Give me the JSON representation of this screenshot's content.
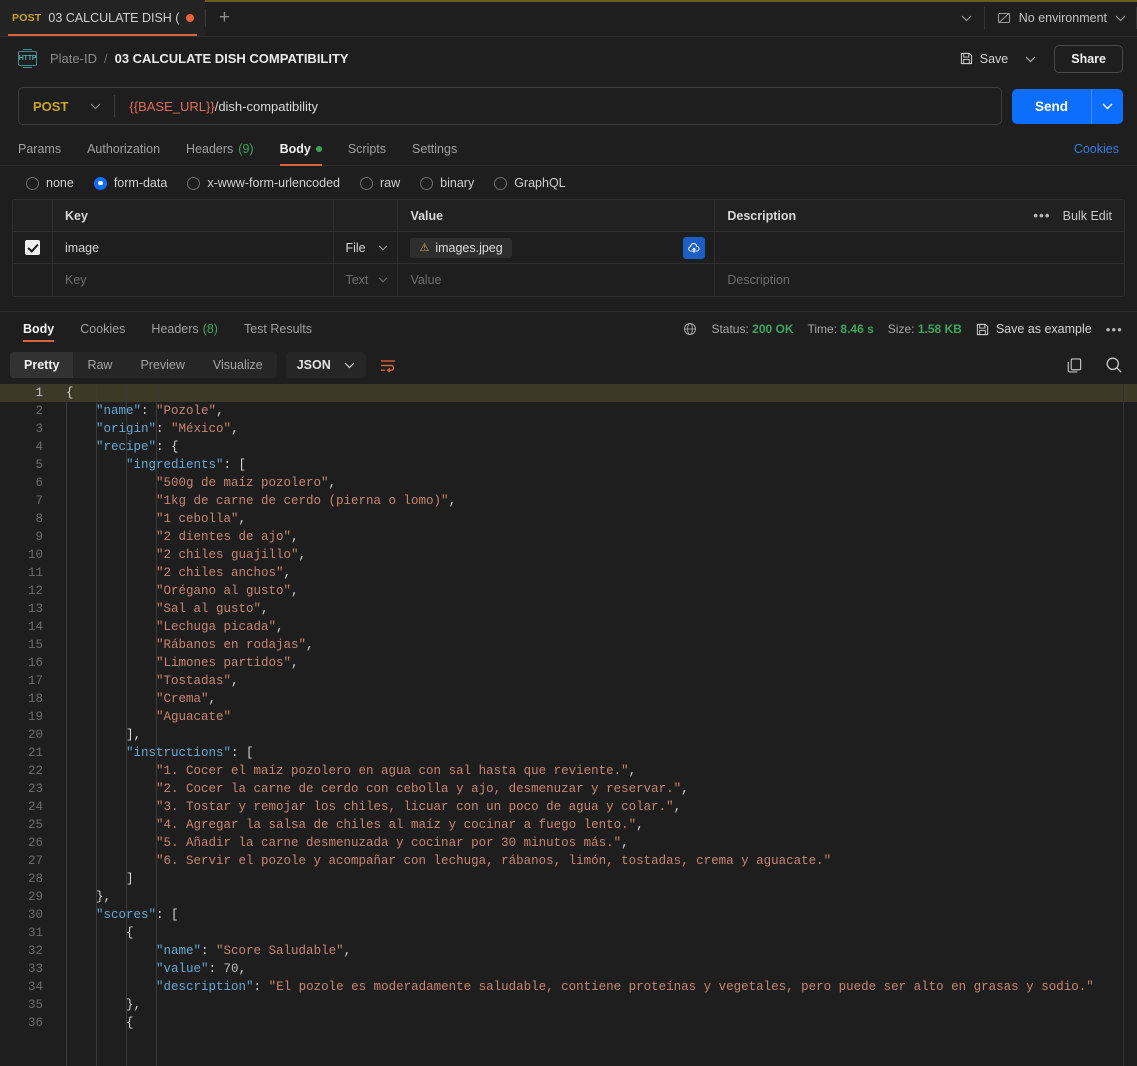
{
  "tabbar": {
    "tab_method": "POST",
    "tab_title": "03 CALCULATE DISH (",
    "add_label": "+",
    "environment": "No environment"
  },
  "header": {
    "badge": "HTTP",
    "collection": "Plate-ID",
    "separator": "/",
    "request_name": "03 CALCULATE DISH COMPATIBILITY",
    "save_label": "Save",
    "share_label": "Share"
  },
  "url_bar": {
    "method": "POST",
    "url_variable": "{{BASE_URL}}",
    "url_path": "/dish-compatibility",
    "send_label": "Send"
  },
  "request_tabs": {
    "items": [
      {
        "label": "Params",
        "active": false
      },
      {
        "label": "Authorization",
        "active": false
      },
      {
        "label": "Headers",
        "count": "(9)",
        "active": false
      },
      {
        "label": "Body",
        "active": true,
        "dot": true
      },
      {
        "label": "Scripts",
        "active": false
      },
      {
        "label": "Settings",
        "active": false
      }
    ],
    "cookies_link": "Cookies"
  },
  "body_type": {
    "options": [
      {
        "label": "none",
        "selected": false
      },
      {
        "label": "form-data",
        "selected": true
      },
      {
        "label": "x-www-form-urlencoded",
        "selected": false
      },
      {
        "label": "raw",
        "selected": false
      },
      {
        "label": "binary",
        "selected": false
      },
      {
        "label": "GraphQL",
        "selected": false
      }
    ]
  },
  "form_data": {
    "headers": {
      "key": "Key",
      "value": "Value",
      "description": "Description",
      "bulk_edit": "Bulk Edit"
    },
    "rows": [
      {
        "checked": true,
        "key": "image",
        "type": "File",
        "value": "images.jpeg",
        "description": ""
      }
    ],
    "placeholder_row": {
      "key": "Key",
      "type": "Text",
      "value": "Value",
      "description": "Description"
    }
  },
  "response": {
    "tabs": [
      {
        "label": "Body",
        "active": true
      },
      {
        "label": "Cookies",
        "active": false
      },
      {
        "label": "Headers",
        "count": "(8)",
        "active": false
      },
      {
        "label": "Test Results",
        "active": false
      }
    ],
    "status_label": "Status:",
    "status_value": "200 OK",
    "time_label": "Time:",
    "time_value": "8.46 s",
    "size_label": "Size:",
    "size_value": "1.58 KB",
    "save_as_example": "Save as example",
    "format_tabs": [
      {
        "label": "Pretty",
        "active": true
      },
      {
        "label": "Raw",
        "active": false
      },
      {
        "label": "Preview",
        "active": false
      },
      {
        "label": "Visualize",
        "active": false
      }
    ],
    "language": "JSON"
  },
  "code": {
    "lines": [
      {
        "n": 1,
        "hl": true,
        "tokens": [
          {
            "t": "p",
            "v": "{"
          }
        ]
      },
      {
        "n": 2,
        "tokens": [
          {
            "t": "p",
            "v": "    "
          },
          {
            "t": "k",
            "v": "\"name\""
          },
          {
            "t": "p",
            "v": ": "
          },
          {
            "t": "s",
            "v": "\"Pozole\""
          },
          {
            "t": "p",
            "v": ","
          }
        ]
      },
      {
        "n": 3,
        "tokens": [
          {
            "t": "p",
            "v": "    "
          },
          {
            "t": "k",
            "v": "\"origin\""
          },
          {
            "t": "p",
            "v": ": "
          },
          {
            "t": "s",
            "v": "\"México\""
          },
          {
            "t": "p",
            "v": ","
          }
        ]
      },
      {
        "n": 4,
        "tokens": [
          {
            "t": "p",
            "v": "    "
          },
          {
            "t": "k",
            "v": "\"recipe\""
          },
          {
            "t": "p",
            "v": ": {"
          }
        ]
      },
      {
        "n": 5,
        "tokens": [
          {
            "t": "p",
            "v": "        "
          },
          {
            "t": "k",
            "v": "\"ingredients\""
          },
          {
            "t": "p",
            "v": ": ["
          }
        ]
      },
      {
        "n": 6,
        "tokens": [
          {
            "t": "p",
            "v": "            "
          },
          {
            "t": "s",
            "v": "\"500g de maíz pozolero\""
          },
          {
            "t": "p",
            "v": ","
          }
        ]
      },
      {
        "n": 7,
        "tokens": [
          {
            "t": "p",
            "v": "            "
          },
          {
            "t": "s",
            "v": "\"1kg de carne de cerdo (pierna o lomo)\""
          },
          {
            "t": "p",
            "v": ","
          }
        ]
      },
      {
        "n": 8,
        "tokens": [
          {
            "t": "p",
            "v": "            "
          },
          {
            "t": "s",
            "v": "\"1 cebolla\""
          },
          {
            "t": "p",
            "v": ","
          }
        ]
      },
      {
        "n": 9,
        "tokens": [
          {
            "t": "p",
            "v": "            "
          },
          {
            "t": "s",
            "v": "\"2 dientes de ajo\""
          },
          {
            "t": "p",
            "v": ","
          }
        ]
      },
      {
        "n": 10,
        "tokens": [
          {
            "t": "p",
            "v": "            "
          },
          {
            "t": "s",
            "v": "\"2 chiles guajillo\""
          },
          {
            "t": "p",
            "v": ","
          }
        ]
      },
      {
        "n": 11,
        "tokens": [
          {
            "t": "p",
            "v": "            "
          },
          {
            "t": "s",
            "v": "\"2 chiles anchos\""
          },
          {
            "t": "p",
            "v": ","
          }
        ]
      },
      {
        "n": 12,
        "tokens": [
          {
            "t": "p",
            "v": "            "
          },
          {
            "t": "s",
            "v": "\"Orégano al gusto\""
          },
          {
            "t": "p",
            "v": ","
          }
        ]
      },
      {
        "n": 13,
        "tokens": [
          {
            "t": "p",
            "v": "            "
          },
          {
            "t": "s",
            "v": "\"Sal al gusto\""
          },
          {
            "t": "p",
            "v": ","
          }
        ]
      },
      {
        "n": 14,
        "tokens": [
          {
            "t": "p",
            "v": "            "
          },
          {
            "t": "s",
            "v": "\"Lechuga picada\""
          },
          {
            "t": "p",
            "v": ","
          }
        ]
      },
      {
        "n": 15,
        "tokens": [
          {
            "t": "p",
            "v": "            "
          },
          {
            "t": "s",
            "v": "\"Rábanos en rodajas\""
          },
          {
            "t": "p",
            "v": ","
          }
        ]
      },
      {
        "n": 16,
        "tokens": [
          {
            "t": "p",
            "v": "            "
          },
          {
            "t": "s",
            "v": "\"Limones partidos\""
          },
          {
            "t": "p",
            "v": ","
          }
        ]
      },
      {
        "n": 17,
        "tokens": [
          {
            "t": "p",
            "v": "            "
          },
          {
            "t": "s",
            "v": "\"Tostadas\""
          },
          {
            "t": "p",
            "v": ","
          }
        ]
      },
      {
        "n": 18,
        "tokens": [
          {
            "t": "p",
            "v": "            "
          },
          {
            "t": "s",
            "v": "\"Crema\""
          },
          {
            "t": "p",
            "v": ","
          }
        ]
      },
      {
        "n": 19,
        "tokens": [
          {
            "t": "p",
            "v": "            "
          },
          {
            "t": "s",
            "v": "\"Aguacate\""
          }
        ]
      },
      {
        "n": 20,
        "tokens": [
          {
            "t": "p",
            "v": "        ],"
          }
        ]
      },
      {
        "n": 21,
        "tokens": [
          {
            "t": "p",
            "v": "        "
          },
          {
            "t": "k",
            "v": "\"instructions\""
          },
          {
            "t": "p",
            "v": ": ["
          }
        ]
      },
      {
        "n": 22,
        "tokens": [
          {
            "t": "p",
            "v": "            "
          },
          {
            "t": "s",
            "v": "\"1. Cocer el maíz pozolero en agua con sal hasta que reviente.\""
          },
          {
            "t": "p",
            "v": ","
          }
        ]
      },
      {
        "n": 23,
        "tokens": [
          {
            "t": "p",
            "v": "            "
          },
          {
            "t": "s",
            "v": "\"2. Cocer la carne de cerdo con cebolla y ajo, desmenuzar y reservar.\""
          },
          {
            "t": "p",
            "v": ","
          }
        ]
      },
      {
        "n": 24,
        "tokens": [
          {
            "t": "p",
            "v": "            "
          },
          {
            "t": "s",
            "v": "\"3. Tostar y remojar los chiles, licuar con un poco de agua y colar.\""
          },
          {
            "t": "p",
            "v": ","
          }
        ]
      },
      {
        "n": 25,
        "tokens": [
          {
            "t": "p",
            "v": "            "
          },
          {
            "t": "s",
            "v": "\"4. Agregar la salsa de chiles al maíz y cocinar a fuego lento.\""
          },
          {
            "t": "p",
            "v": ","
          }
        ]
      },
      {
        "n": 26,
        "tokens": [
          {
            "t": "p",
            "v": "            "
          },
          {
            "t": "s",
            "v": "\"5. Añadir la carne desmenuzada y cocinar por 30 minutos más.\""
          },
          {
            "t": "p",
            "v": ","
          }
        ]
      },
      {
        "n": 27,
        "tokens": [
          {
            "t": "p",
            "v": "            "
          },
          {
            "t": "s",
            "v": "\"6. Servir el pozole y acompañar con lechuga, rábanos, limón, tostadas, crema y aguacate.\""
          }
        ]
      },
      {
        "n": 28,
        "tokens": [
          {
            "t": "p",
            "v": "        ]"
          }
        ]
      },
      {
        "n": 29,
        "tokens": [
          {
            "t": "p",
            "v": "    },"
          }
        ]
      },
      {
        "n": 30,
        "tokens": [
          {
            "t": "p",
            "v": "    "
          },
          {
            "t": "k",
            "v": "\"scores\""
          },
          {
            "t": "p",
            "v": ": ["
          }
        ]
      },
      {
        "n": 31,
        "tokens": [
          {
            "t": "p",
            "v": "        {"
          }
        ]
      },
      {
        "n": 32,
        "tokens": [
          {
            "t": "p",
            "v": "            "
          },
          {
            "t": "k",
            "v": "\"name\""
          },
          {
            "t": "p",
            "v": ": "
          },
          {
            "t": "s",
            "v": "\"Score Saludable\""
          },
          {
            "t": "p",
            "v": ","
          }
        ]
      },
      {
        "n": 33,
        "tokens": [
          {
            "t": "p",
            "v": "            "
          },
          {
            "t": "k",
            "v": "\"value\""
          },
          {
            "t": "p",
            "v": ": "
          },
          {
            "t": "n",
            "v": "70"
          },
          {
            "t": "p",
            "v": ","
          }
        ]
      },
      {
        "n": 34,
        "tokens": [
          {
            "t": "p",
            "v": "            "
          },
          {
            "t": "k",
            "v": "\"description\""
          },
          {
            "t": "p",
            "v": ": "
          },
          {
            "t": "s",
            "v": "\"El pozole es moderadamente saludable, contiene proteínas y vegetales, pero puede ser alto en grasas y sodio.\""
          }
        ]
      },
      {
        "n": 35,
        "tokens": [
          {
            "t": "p",
            "v": "        },"
          }
        ]
      },
      {
        "n": 36,
        "tokens": [
          {
            "t": "p",
            "v": "        {"
          }
        ]
      }
    ]
  },
  "colors": {
    "accent_orange": "#d4643c",
    "send_blue": "#0d6efd",
    "status_green": "#3ba55d",
    "method_yellow": "#c9a227",
    "json_key": "#62a9d6",
    "json_string": "#c98571"
  }
}
